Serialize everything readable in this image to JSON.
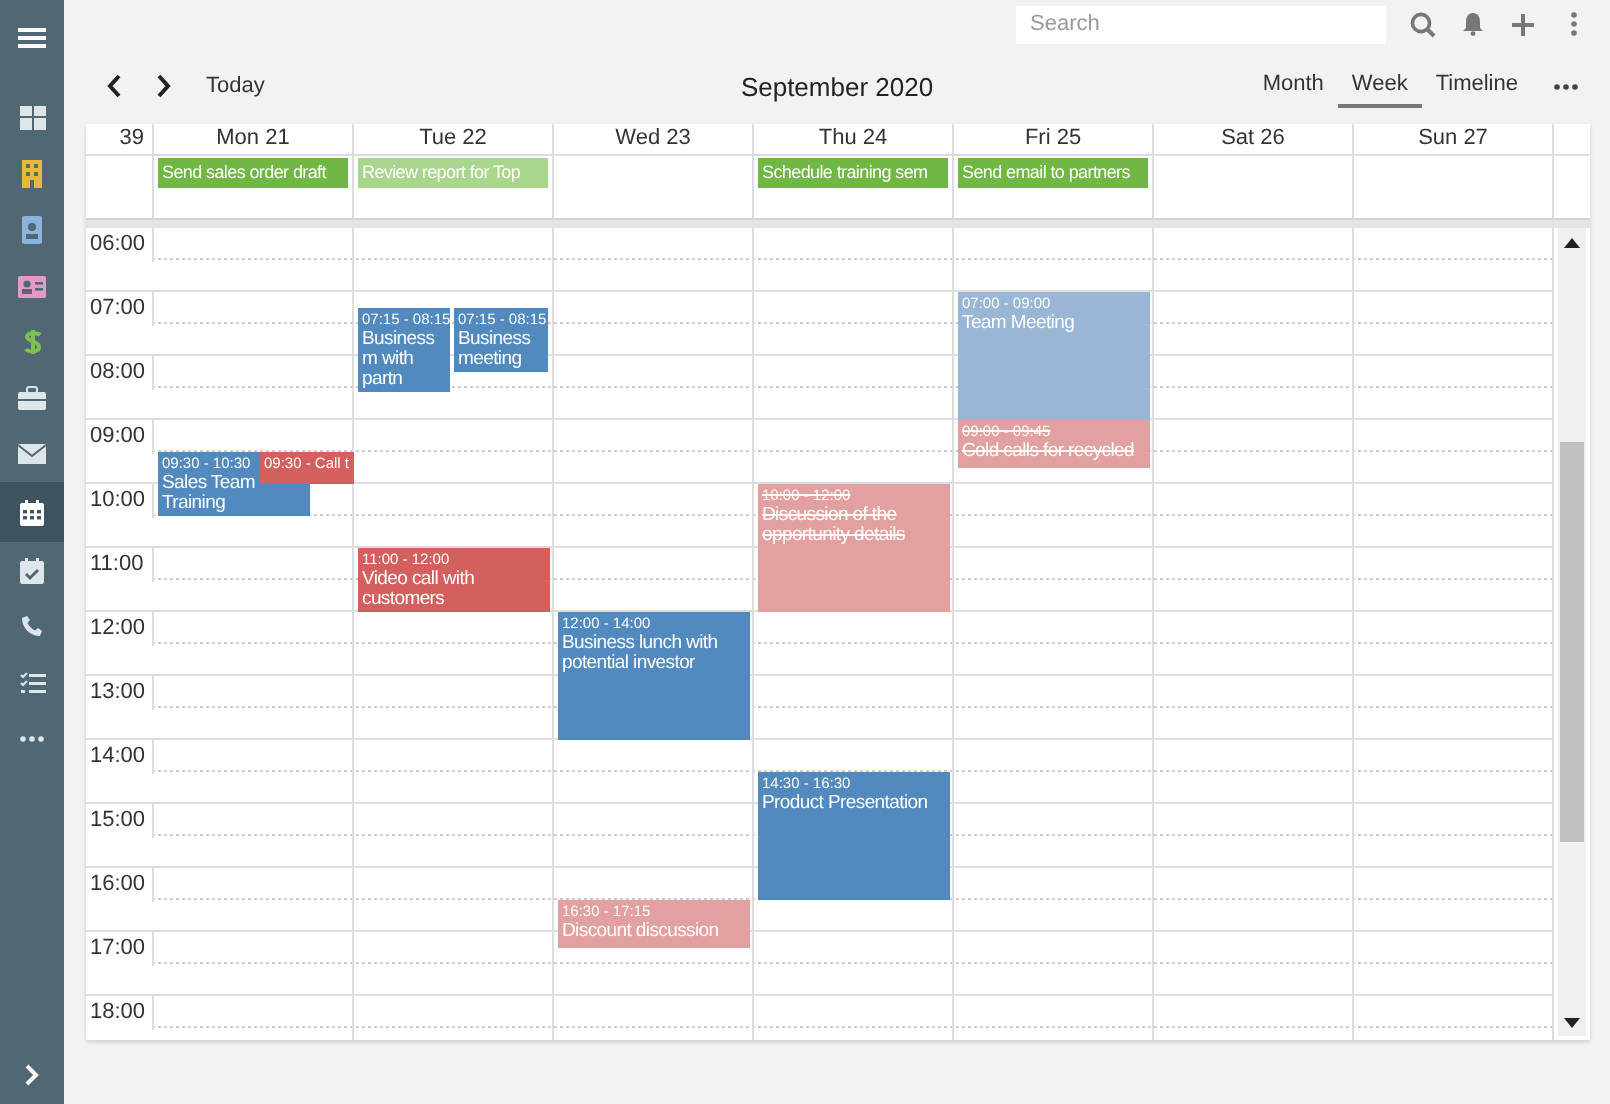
{
  "sidebar": {
    "items": [
      {
        "kind": "dashboard",
        "selected": false
      },
      {
        "kind": "building",
        "selected": false
      },
      {
        "kind": "contact",
        "selected": false
      },
      {
        "kind": "card",
        "selected": false
      },
      {
        "kind": "dollar",
        "selected": false
      },
      {
        "kind": "briefcase",
        "selected": false
      },
      {
        "kind": "mail",
        "selected": false
      },
      {
        "kind": "calendar",
        "selected": true
      },
      {
        "kind": "calendar-check",
        "selected": false
      },
      {
        "kind": "phone",
        "selected": false
      },
      {
        "kind": "tasks",
        "selected": false
      },
      {
        "kind": "more",
        "selected": false
      }
    ]
  },
  "search": {
    "placeholder": "Search"
  },
  "nav": {
    "today": "Today",
    "title": "September 2020"
  },
  "views": [
    {
      "label": "Month",
      "selected": false
    },
    {
      "label": "Week",
      "selected": true
    },
    {
      "label": "Timeline",
      "selected": false
    }
  ],
  "week_number": "39",
  "hours": [
    "06:00",
    "07:00",
    "08:00",
    "09:00",
    "10:00",
    "11:00",
    "12:00",
    "13:00",
    "14:00",
    "15:00",
    "16:00",
    "17:00",
    "18:00"
  ],
  "days": [
    {
      "label": "Mon 21",
      "all_day": [
        {
          "title": "Send sales order draft",
          "color": "#70b744"
        }
      ],
      "events": [
        {
          "kind": "block",
          "time": "09:30 - 10:30",
          "title": "Sales Team Training",
          "color": "#5289be",
          "done": false
        },
        {
          "kind": "compact",
          "text": "09:30 - Call t",
          "color": "#d45f5f",
          "done": false
        }
      ]
    },
    {
      "label": "Tue 22",
      "all_day": [
        {
          "title": "Review report for Top",
          "color": "#a9d68d"
        }
      ],
      "events": [
        {
          "kind": "block",
          "time": "07:15 - 08:15",
          "title": "Business m with partn",
          "color": "#5289be",
          "done": false
        },
        {
          "kind": "block",
          "time": "07:15 - 08:15",
          "title": "Business meeting",
          "color": "#5289be",
          "done": false
        },
        {
          "kind": "block",
          "time": "11:00 - 12:00",
          "title": "Video call with customers",
          "color": "#d45f5f",
          "done": false
        }
      ]
    },
    {
      "label": "Wed 23",
      "events": [
        {
          "kind": "block",
          "time": "12:00 - 14:00",
          "title": "Business lunch with potential investor",
          "color": "#5289be",
          "done": false
        },
        {
          "kind": "block",
          "time": "16:30 - 17:15",
          "title": "Discount discussion",
          "color": "#e3a0a0",
          "done": false
        }
      ]
    },
    {
      "label": "Thu 24",
      "all_day": [
        {
          "title": "Schedule training sem",
          "color": "#70b744"
        }
      ],
      "events": [
        {
          "kind": "block",
          "time": "10:00 - 12:00",
          "title": "Discussion of the opportunity details",
          "color": "#e3a0a0",
          "done": true
        },
        {
          "kind": "block",
          "time": "14:30 - 16:30",
          "title": "Product Presentation",
          "color": "#5289be",
          "done": false
        }
      ]
    },
    {
      "label": "Fri 25",
      "all_day": [
        {
          "title": "Send email to partners",
          "color": "#70b744"
        }
      ],
      "events": [
        {
          "kind": "block",
          "time": "07:00 - 09:00",
          "title": "Team Meeting",
          "color": "#99b6d5",
          "done": false
        },
        {
          "kind": "block",
          "time": "09:00 - 09:45",
          "title": "Cold calls for recycled",
          "color": "#e3a0a0",
          "done": true
        }
      ]
    },
    {
      "label": "Sat 26"
    },
    {
      "label": "Sun 27"
    }
  ]
}
